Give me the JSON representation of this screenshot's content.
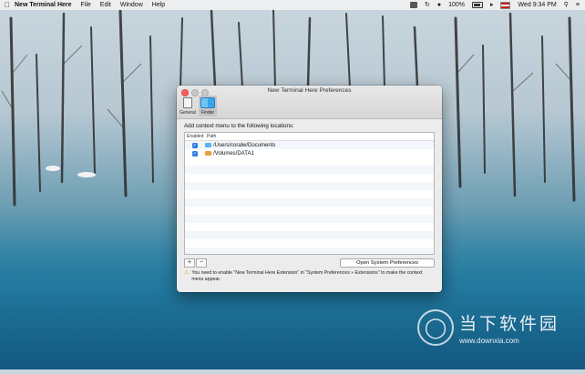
{
  "menubar": {
    "app_name": "New Terminal Here",
    "items": [
      "File",
      "Edit",
      "Window",
      "Help"
    ],
    "battery": "100%",
    "clock": "Wed 9:34 PM"
  },
  "window": {
    "title": "New Terminal Here Preferences",
    "tabs": [
      {
        "label": "General",
        "icon": "general-icon"
      },
      {
        "label": "Finder",
        "icon": "finder-icon"
      }
    ],
    "heading": "Add context menu to the following locations:",
    "table": {
      "columns": [
        "Enabled",
        "Path"
      ],
      "rows": [
        {
          "enabled": true,
          "path": "/Users/coralw/Documents",
          "icon": "folder-blue-icon"
        },
        {
          "enabled": true,
          "path": "/Volumes/DATA1",
          "icon": "drive-orange-icon"
        }
      ]
    },
    "add_label": "+",
    "remove_label": "−",
    "open_prefs_label": "Open System Preferences",
    "notice": "You need to enable \"New Terminal Here Extension\" in \"System Preferences » Extensions\" to make the context menu appear."
  },
  "watermark": {
    "brand": "当下软件园",
    "url": "www.downxia.com"
  },
  "colors": {
    "accent": "#2f7de1",
    "close": "#fc605c"
  }
}
